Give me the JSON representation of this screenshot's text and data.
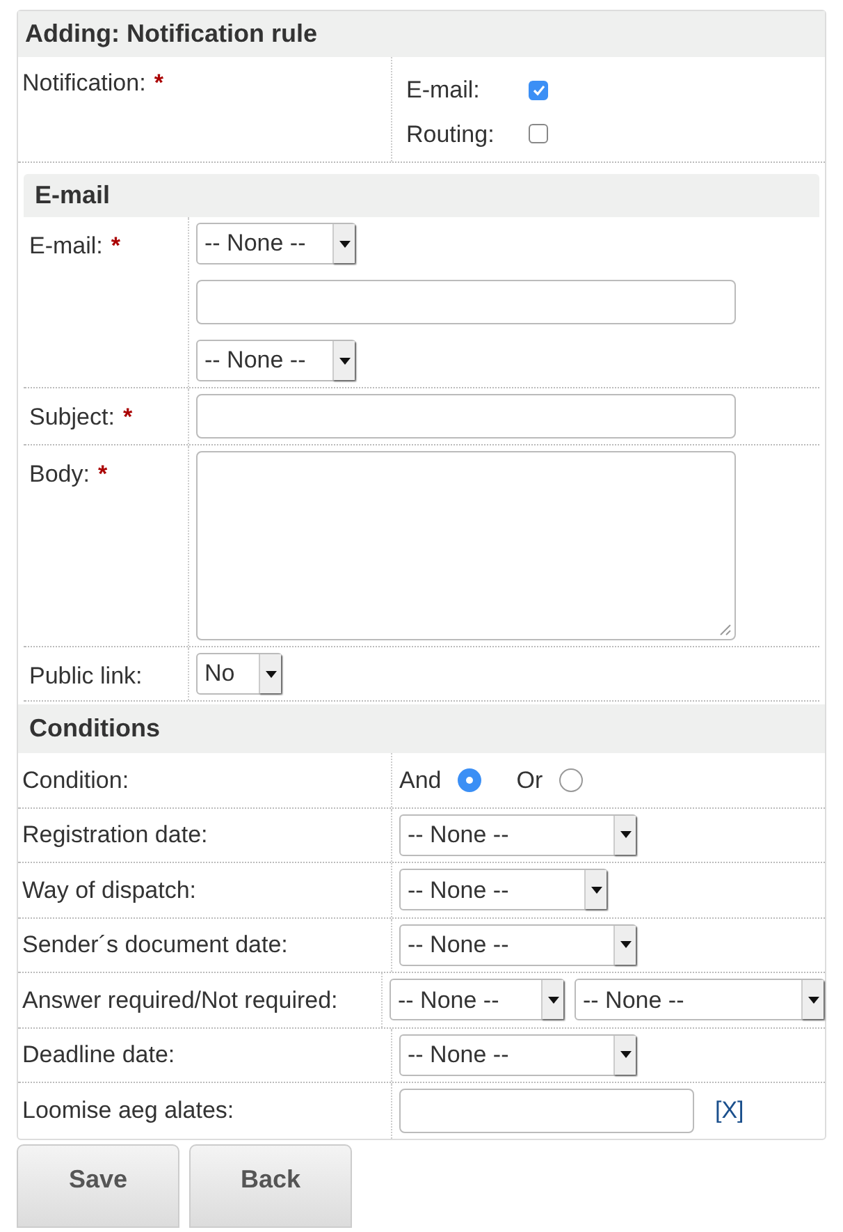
{
  "title": "Adding: Notification rule",
  "notification": {
    "label": "Notification:",
    "required_mark": "*",
    "options": [
      {
        "label": "E-mail:",
        "checked": true
      },
      {
        "label": "Routing:",
        "checked": false
      }
    ]
  },
  "email_section": {
    "title": "E-mail",
    "fields": [
      {
        "label": "E-mail:",
        "required_mark": "*",
        "controls": [
          {
            "kind": "select",
            "value": "-- None --"
          },
          {
            "kind": "input"
          },
          {
            "kind": "select",
            "value": "-- None --"
          }
        ]
      },
      {
        "label": "Subject:",
        "required_mark": "*",
        "controls": [
          {
            "kind": "input"
          }
        ]
      },
      {
        "label": "Body:",
        "required_mark": "*",
        "controls": [
          {
            "kind": "textarea"
          }
        ]
      },
      {
        "label": "Public link:",
        "controls": [
          {
            "kind": "select",
            "value": "No"
          }
        ]
      }
    ]
  },
  "conditions": {
    "title": "Conditions",
    "rows": [
      {
        "label": "Condition:",
        "controls": [
          {
            "kind": "radio",
            "label": "And",
            "selected": true
          },
          {
            "kind": "radio",
            "label": "Or",
            "selected": false
          }
        ]
      },
      {
        "label": "Registration date:",
        "controls": [
          {
            "kind": "select",
            "value": "-- None --"
          }
        ]
      },
      {
        "label": "Way of dispatch:",
        "controls": [
          {
            "kind": "select",
            "value": "-- None --"
          }
        ]
      },
      {
        "label": "Sender´s document date:",
        "controls": [
          {
            "kind": "select",
            "value": "-- None --"
          }
        ]
      },
      {
        "label": "Answer required/Not required:",
        "controls": [
          {
            "kind": "select",
            "value": "-- None --"
          },
          {
            "kind": "select",
            "value": "-- None --"
          }
        ]
      },
      {
        "label": "Deadline date:",
        "controls": [
          {
            "kind": "select",
            "value": "-- None --"
          }
        ]
      },
      {
        "label": "Loomise aeg alates:",
        "controls": [
          {
            "kind": "date"
          },
          {
            "kind": "link",
            "label": "[X]"
          }
        ]
      }
    ]
  },
  "buttons": [
    "Save",
    "Back"
  ]
}
